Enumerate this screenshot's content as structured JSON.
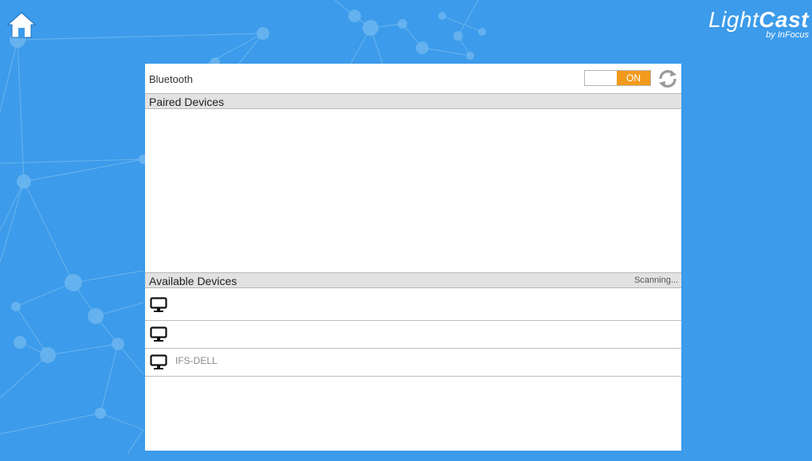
{
  "brand": {
    "logo_light": "Light",
    "logo_cast": "Cast",
    "logo_sub": "by InFocus"
  },
  "bluetooth": {
    "label": "Bluetooth",
    "toggle_state": "ON",
    "toggle_color": "#f29a1c"
  },
  "paired": {
    "title": "Paired Devices",
    "devices": []
  },
  "available": {
    "title": "Available Devices",
    "status": "Scanning...",
    "devices": [
      {
        "name": "",
        "icon": "monitor-icon"
      },
      {
        "name": "",
        "icon": "monitor-icon"
      },
      {
        "name": "IFS-DELL",
        "icon": "monitor-icon"
      }
    ]
  },
  "colors": {
    "background": "#3c9bea",
    "accent": "#f29a1c"
  }
}
